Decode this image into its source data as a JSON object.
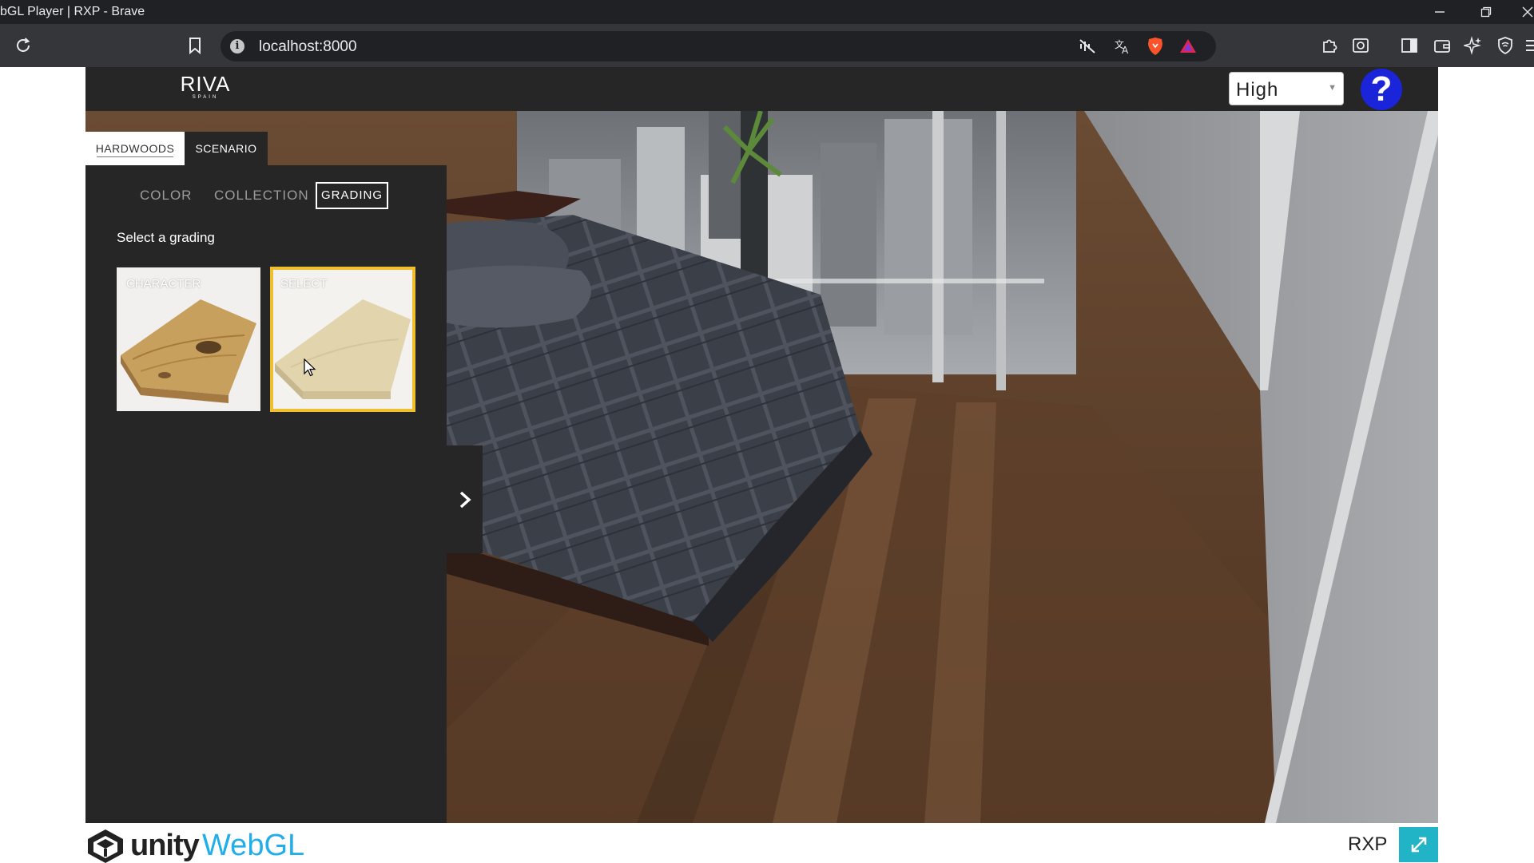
{
  "browser": {
    "window_title": "bGL Player | RXP - Brave",
    "url": "localhost:8000"
  },
  "app": {
    "logo_text": "RIVA",
    "logo_subtext": "SPAIN",
    "quality": {
      "selected": "High"
    },
    "help_label": "?",
    "tabs": [
      {
        "label": "HARDWOODS",
        "active": true
      },
      {
        "label": "SCENARIO",
        "active": false
      }
    ],
    "subtabs": [
      {
        "label": "COLOR",
        "active": false
      },
      {
        "label": "COLLECTION",
        "active": false
      },
      {
        "label": "GRADING",
        "active": true
      }
    ],
    "prompt": "Select a grading",
    "gradings": [
      {
        "label": "CHARACTER",
        "selected": false
      },
      {
        "label": "SELECT",
        "selected": true
      }
    ],
    "selected_color": "#f0bf2e"
  },
  "footer": {
    "unity": "unity",
    "webgl": "WebGL",
    "product": "RXP"
  }
}
